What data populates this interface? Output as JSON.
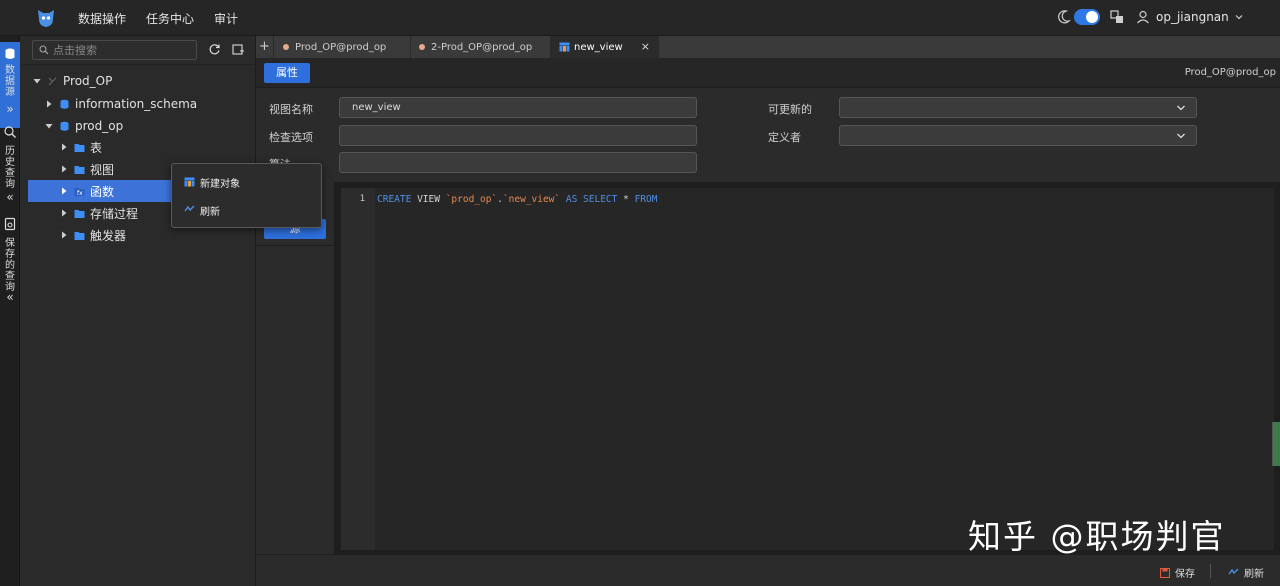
{
  "topbar": {
    "nav": [
      "数据操作",
      "任务中心",
      "审计"
    ],
    "user_name": "op_jiangnan",
    "accent": "#2f79e6"
  },
  "rail": {
    "datasource": "数据源",
    "history": "历史查询",
    "saved": "保存的查询",
    "collapse1": "»",
    "collapse2": "«",
    "collapse3": "«"
  },
  "tree": {
    "search_placeholder": "点击搜索",
    "root": "Prod_OP",
    "db1": "information_schema",
    "db2": "prod_op",
    "items": [
      "表",
      "视图",
      "函数",
      "存储过程",
      "触发器"
    ]
  },
  "context_menu": {
    "new_object": "新建对象",
    "refresh": "刷新"
  },
  "tabs": [
    {
      "label": "Prod_OP@prod_op"
    },
    {
      "label": "2-Prod_OP@prod_op"
    },
    {
      "label": "new_view"
    }
  ],
  "tab_close": "×",
  "tab_add": "+",
  "subheader": {
    "properties_button": "属性",
    "connection": "Prod_OP@prod_op"
  },
  "form": {
    "view_name_label": "视图名称",
    "view_name_value": "new_view",
    "check_option_label": "检查选项",
    "algorithm_label": "算法",
    "updatable_label": "可更新的",
    "definer_label": "定义者"
  },
  "side": {
    "button_label": "源"
  },
  "editor": {
    "line_number": "1",
    "kw_create": "CREATE",
    "kw_view": "VIEW",
    "schema": "`prod_op`",
    "dot": ".",
    "view": "`new_view`",
    "kw_as": "AS",
    "kw_select": "SELECT",
    "star": "*",
    "kw_from": "FROM"
  },
  "footer": {
    "save": "保存",
    "refresh": "刷新"
  },
  "watermark": "知乎 @职场判官"
}
